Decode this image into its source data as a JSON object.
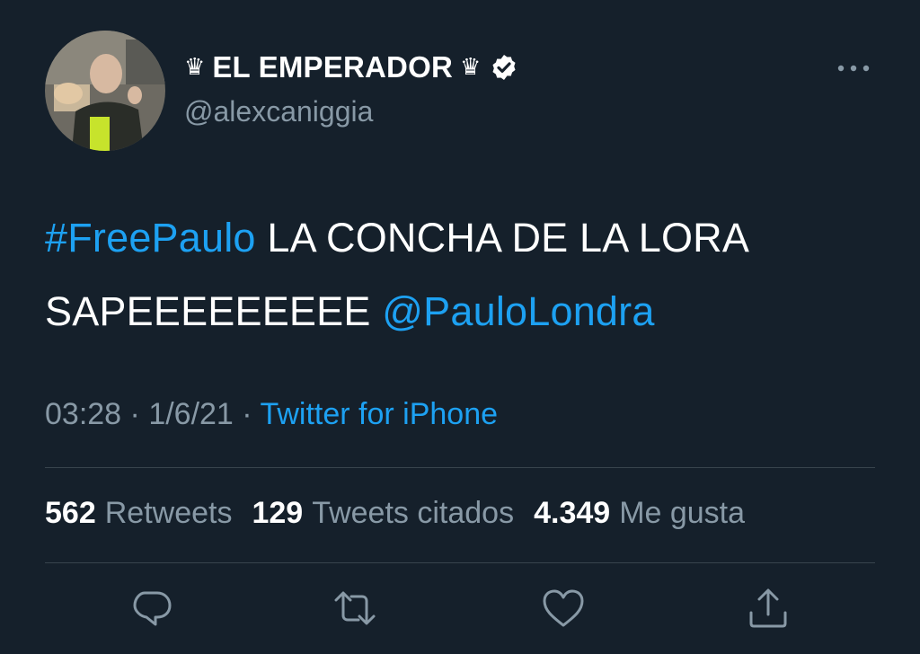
{
  "tweet": {
    "display_name": "EL EMPERADOR",
    "crown_symbol": "♛",
    "handle": "@alexcaniggia",
    "text": {
      "hashtag": "#FreePaulo",
      "line1_rest": " LA CONCHA DE LA LORA",
      "line2_plain": "SAPEEEEEEEEE ",
      "mention": "@PauloLondra"
    },
    "meta": {
      "time": "03:28",
      "separator": " · ",
      "date": "1/6/21",
      "source": "Twitter for iPhone"
    },
    "stats": [
      {
        "count": "562",
        "label": "Retweets"
      },
      {
        "count": "129",
        "label": "Tweets citados"
      },
      {
        "count": "4.349",
        "label": "Me gusta"
      }
    ]
  },
  "icons": {
    "verified": "verified-badge-icon",
    "more": "more-options-icon",
    "reply": "reply-icon",
    "retweet": "retweet-icon",
    "like": "heart-icon",
    "share": "share-icon"
  },
  "colors": {
    "background": "#15202b",
    "link": "#1da1f2",
    "secondary_text": "#8899a6",
    "divider": "#38444d"
  }
}
